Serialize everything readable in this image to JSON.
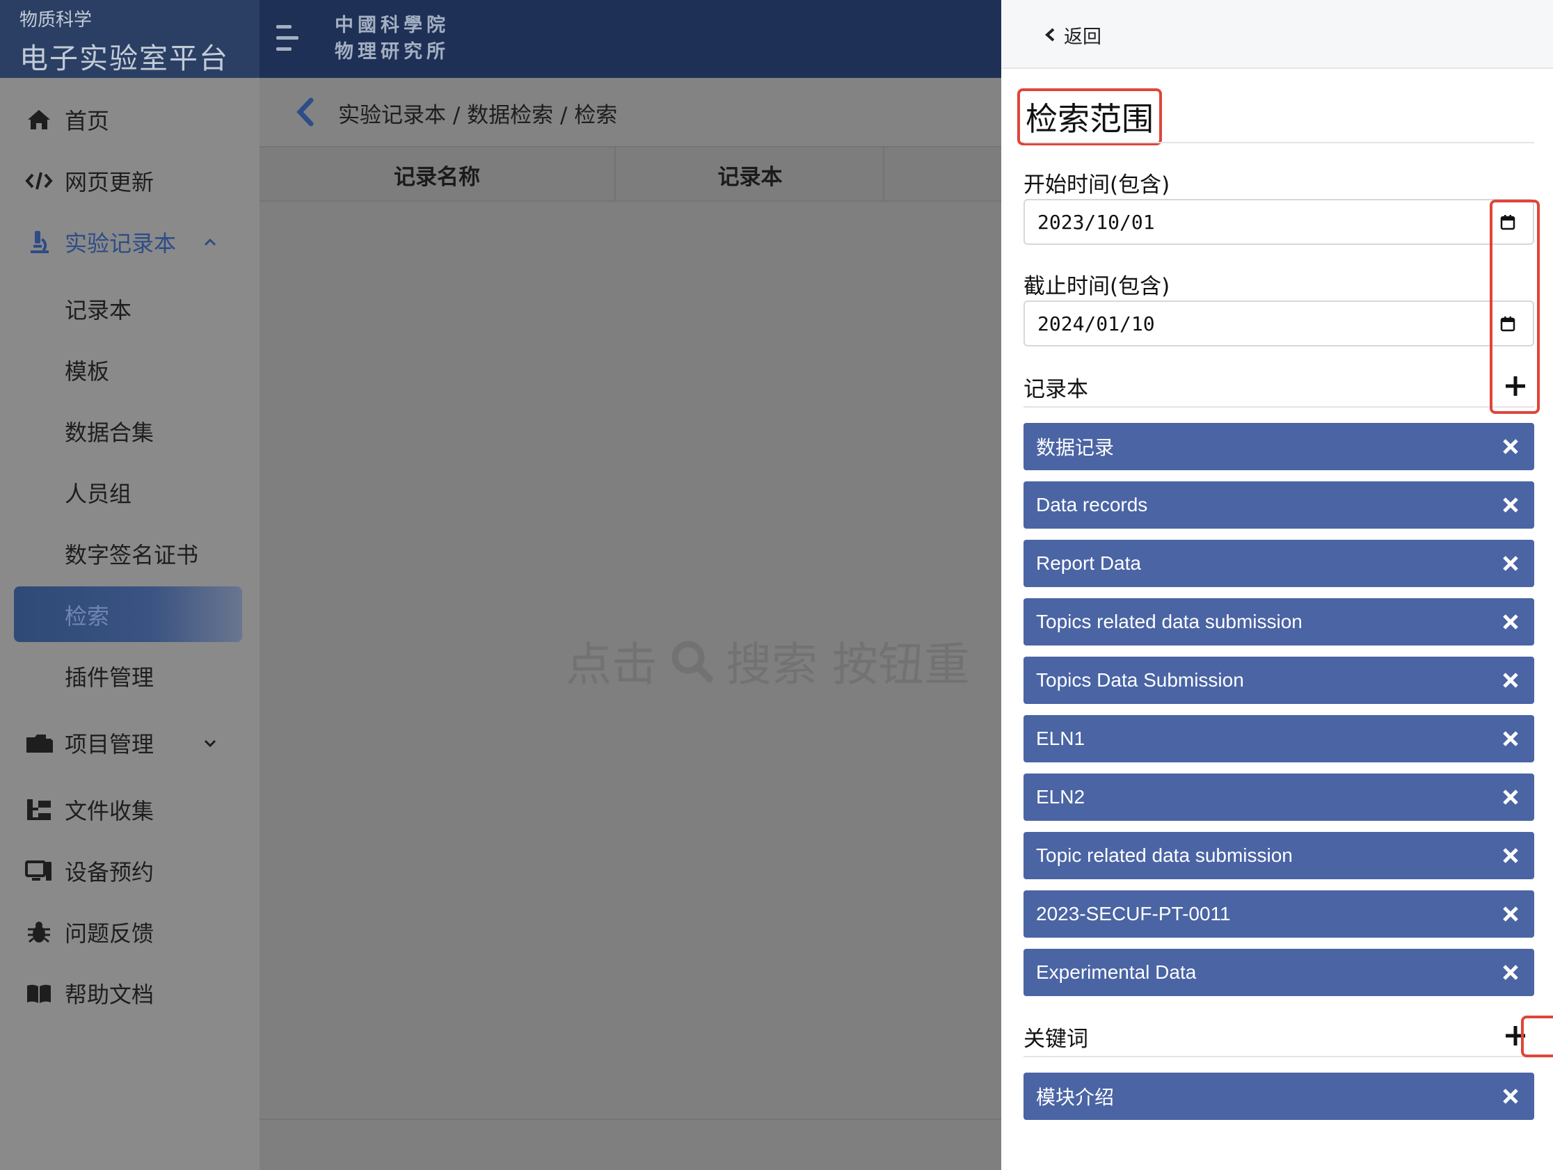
{
  "brand": {
    "subtitle": "物质科学",
    "title": "电子实验室平台"
  },
  "topbar": {
    "institute_line1": "中國科學院",
    "institute_line2": "物理研究所"
  },
  "sidebar": {
    "items": [
      {
        "label": "首页",
        "icon": "home-icon"
      },
      {
        "label": "网页更新",
        "icon": "code-icon"
      },
      {
        "label": "实验记录本",
        "icon": "microscope-icon",
        "expanded": true
      },
      {
        "label": "记录本"
      },
      {
        "label": "模板"
      },
      {
        "label": "数据合集"
      },
      {
        "label": "人员组"
      },
      {
        "label": "数字签名证书"
      },
      {
        "label": "检索",
        "active": true
      },
      {
        "label": "插件管理"
      },
      {
        "label": "项目管理",
        "icon": "folder-icon",
        "expanded": false
      },
      {
        "label": "文件收集",
        "icon": "sitemap-icon"
      },
      {
        "label": "设备预约",
        "icon": "desktop-icon"
      },
      {
        "label": "问题反馈",
        "icon": "bug-icon"
      },
      {
        "label": "帮助文档",
        "icon": "book-icon"
      }
    ]
  },
  "content": {
    "breadcrumb": "实验记录本 / 数据检索 / 检索",
    "columns": [
      "记录名称",
      "记录本"
    ],
    "empty_hint_before": "点击",
    "empty_hint_after": "搜索 按钮重"
  },
  "panel": {
    "back_label": "返回",
    "section_title": "检索范围",
    "start_label": "开始时间(包含)",
    "start_value": "2023/10/01",
    "end_label": "截止时间(包含)",
    "end_value": "2024/01/10",
    "notebooks_label": "记录本",
    "notebooks": [
      "数据记录",
      "Data records",
      "Report Data",
      "Topics related data submission",
      "Topics Data Submission",
      "ELN1",
      "ELN2",
      "Topic related data submission",
      "2023-SECUF-PT-0011",
      "Experimental Data"
    ],
    "keywords_label": "关键词",
    "keywords": [
      "模块介绍"
    ]
  },
  "colors": {
    "accent": "#4a64a4",
    "highlight": "#e0453a",
    "topbar": "#1e3055"
  }
}
